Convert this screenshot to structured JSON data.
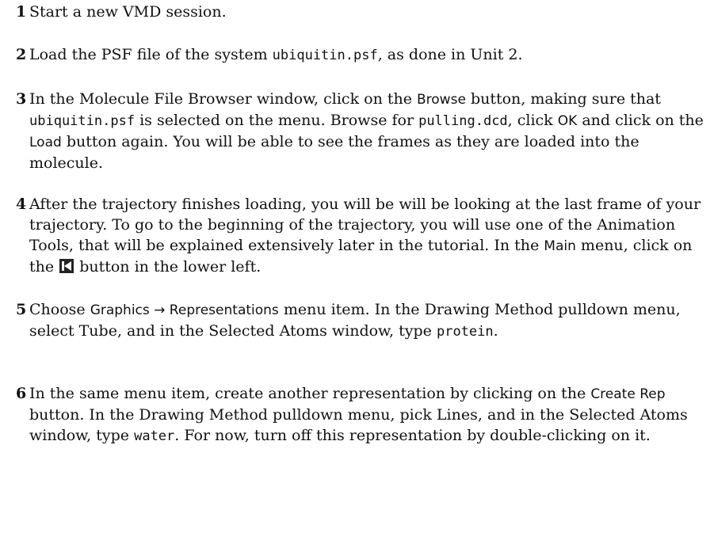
{
  "steps": [
    {
      "num": "1",
      "t": [
        "Start a new VMD session."
      ]
    },
    {
      "num": "2",
      "t": [
        "Load the PSF file of the system ",
        "ubiquitin.psf",
        ", as done in Unit 2."
      ]
    },
    {
      "num": "3",
      "t": [
        "In the Molecule File Browser window, click on the ",
        "Browse",
        " button, making sure that ",
        "ubiquitin.psf",
        " is selected on the menu. Browse for ",
        "pulling.dcd",
        ", click ",
        "OK",
        " and click on the ",
        "Load",
        " button again. You will be able to see the frames as they are loaded into the molecule."
      ]
    },
    {
      "num": "4",
      "t": [
        "After the trajectory finishes loading, you will be will be looking at the last frame of your trajectory. To go to the beginning of the trajectory, you will use one of the Animation Tools, that will be explained extensively later in the tutorial. In the ",
        "Main",
        " menu, click on the ",
        " button in the lower left."
      ]
    },
    {
      "num": "5",
      "t": [
        "Choose ",
        "Graphics → Representations",
        " menu item. In the Drawing Method pulldown menu, select Tube, and in the Selected Atoms window, type ",
        "protein",
        "."
      ]
    },
    {
      "num": "6",
      "t": [
        "In the same menu item, create another representation by clicking on the ",
        "Create Rep",
        " button. In the Drawing Method pulldown menu, pick Lines, and in the Selected Atoms window, type ",
        "water",
        ". For now, turn off this representation by double-clicking on it."
      ]
    }
  ],
  "icons": {
    "rewind": "go-to-start-icon"
  }
}
